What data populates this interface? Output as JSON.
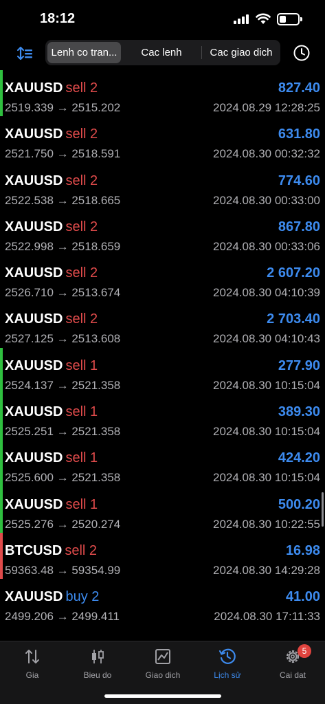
{
  "status": {
    "time": "18:12"
  },
  "segments": [
    {
      "label": "Lenh co tran...",
      "active": true
    },
    {
      "label": "Cac lenh",
      "active": false
    },
    {
      "label": "Cac giao dich",
      "active": false
    }
  ],
  "trades": [
    {
      "symbol": "XAUUSD",
      "side": "sell 2",
      "type": "sell",
      "prices": "2519.339 → 2515.202",
      "profit": "827.40",
      "time": "2024.08.29 12:28:25",
      "bar": "#2fbf3f"
    },
    {
      "symbol": "XAUUSD",
      "side": "sell 2",
      "type": "sell",
      "prices": "2521.750 → 2518.591",
      "profit": "631.80",
      "time": "2024.08.30 00:32:32",
      "bar": ""
    },
    {
      "symbol": "XAUUSD",
      "side": "sell 2",
      "type": "sell",
      "prices": "2522.538 → 2518.665",
      "profit": "774.60",
      "time": "2024.08.30 00:33:00",
      "bar": ""
    },
    {
      "symbol": "XAUUSD",
      "side": "sell 2",
      "type": "sell",
      "prices": "2522.998 → 2518.659",
      "profit": "867.80",
      "time": "2024.08.30 00:33:06",
      "bar": ""
    },
    {
      "symbol": "XAUUSD",
      "side": "sell 2",
      "type": "sell",
      "prices": "2526.710 → 2513.674",
      "profit": "2 607.20",
      "time": "2024.08.30 04:10:39",
      "bar": ""
    },
    {
      "symbol": "XAUUSD",
      "side": "sell 2",
      "type": "sell",
      "prices": "2527.125 → 2513.608",
      "profit": "2 703.40",
      "time": "2024.08.30 04:10:43",
      "bar": ""
    },
    {
      "symbol": "XAUUSD",
      "side": "sell 1",
      "type": "sell",
      "prices": "2524.137 → 2521.358",
      "profit": "277.90",
      "time": "2024.08.30 10:15:04",
      "bar": "#2fbf3f"
    },
    {
      "symbol": "XAUUSD",
      "side": "sell 1",
      "type": "sell",
      "prices": "2525.251 → 2521.358",
      "profit": "389.30",
      "time": "2024.08.30 10:15:04",
      "bar": "#2fbf3f"
    },
    {
      "symbol": "XAUUSD",
      "side": "sell 1",
      "type": "sell",
      "prices": "2525.600 → 2521.358",
      "profit": "424.20",
      "time": "2024.08.30 10:15:04",
      "bar": "#2fbf3f"
    },
    {
      "symbol": "XAUUSD",
      "side": "sell 1",
      "type": "sell",
      "prices": "2525.276 → 2520.274",
      "profit": "500.20",
      "time": "2024.08.30 10:22:55",
      "bar": "#2fbf3f"
    },
    {
      "symbol": "BTCUSD",
      "side": "sell 2",
      "type": "sell",
      "prices": "59363.48 → 59354.99",
      "profit": "16.98",
      "time": "2024.08.30 14:29:28",
      "bar": "#e04b4b"
    },
    {
      "symbol": "XAUUSD",
      "side": "buy 2",
      "type": "buy",
      "prices": "2499.206 → 2499.411",
      "profit": "41.00",
      "time": "2024.08.30 17:11:33",
      "bar": ""
    }
  ],
  "tabs": [
    {
      "label": "Gia",
      "icon": "arrows-updown-icon",
      "active": false
    },
    {
      "label": "Bieu do",
      "icon": "candlestick-icon",
      "active": false
    },
    {
      "label": "Giao dich",
      "icon": "trade-chart-icon",
      "active": false
    },
    {
      "label": "Lịch sử",
      "icon": "history-icon",
      "active": true
    },
    {
      "label": "Cai dat",
      "icon": "gear-icon",
      "active": false,
      "badge": "5"
    }
  ],
  "colors": {
    "sell": "#e04b4b",
    "buy": "#3d8bef",
    "profit": "#3d8bef",
    "accent": "#3d8bef",
    "green_bar": "#2fbf3f"
  }
}
